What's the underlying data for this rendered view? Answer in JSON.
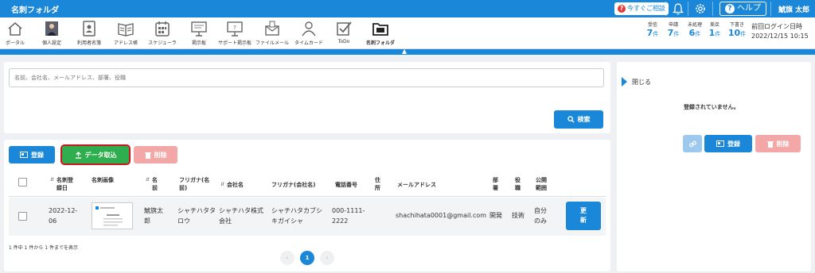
{
  "header": {
    "app_title": "名刺フォルダ",
    "contact_label": "今すぐご相談",
    "help_label": "ヘルプ",
    "user_name": "鯱旗 太郎"
  },
  "nav": {
    "items": [
      {
        "label": "ポータル",
        "icon": "home-icon"
      },
      {
        "label": "個人設定",
        "icon": "avatar-icon"
      },
      {
        "label": "利用者名簿",
        "icon": "contact-book-icon"
      },
      {
        "label": "アドレス帳",
        "icon": "address-book-icon"
      },
      {
        "label": "スケジューラ",
        "icon": "calendar-icon"
      },
      {
        "label": "掲示板",
        "icon": "board-icon"
      },
      {
        "label": "サポート掲示板",
        "icon": "support-board-icon"
      },
      {
        "label": "ファイルメール",
        "icon": "file-mail-icon"
      },
      {
        "label": "タイムカード",
        "icon": "timecard-icon"
      },
      {
        "label": "ToDo",
        "icon": "todo-check-icon"
      },
      {
        "label": "名刺フォルダ",
        "icon": "business-card-folder-icon"
      }
    ],
    "active": "名刺フォルダ"
  },
  "stats": [
    {
      "label": "受信",
      "value": "7",
      "unit": "件"
    },
    {
      "label": "申請",
      "value": "7",
      "unit": "件"
    },
    {
      "label": "未処理",
      "value": "6",
      "unit": "件"
    },
    {
      "label": "差戻",
      "value": "1",
      "unit": "件"
    },
    {
      "label": "下書き",
      "value": "10",
      "unit": "件"
    }
  ],
  "last_login": {
    "label": "前回ログイン日時",
    "value": "2022/12/15 10:15"
  },
  "search": {
    "placeholder": "名前、会社名、メールアドレス、部署、役職",
    "button_label": "検索"
  },
  "toolbar": {
    "register_label": "登録",
    "import_label": "データ取込",
    "delete_label": "削除"
  },
  "table": {
    "headers": {
      "reg_date": "名刺登録日",
      "image": "名刺画像",
      "name": "名前",
      "furigana": "フリガナ(名前)",
      "company": "会社名",
      "company_furigana": "フリガナ(会社名)",
      "phone": "電話番号",
      "address": "住所",
      "email": "メールアドレス",
      "department": "部署",
      "position": "役職",
      "scope": "公開範囲"
    },
    "rows": [
      {
        "reg_date": "2022-12-06",
        "name": "鯱旗太郎",
        "furigana": "シャチハタタロウ",
        "company": "シャチハタ株式会社",
        "company_furigana": "シャチハタカブシキガイシャ",
        "phone": "000-1111-2222",
        "address": "",
        "email": "shachihata0001@gmail.com",
        "department": "開発",
        "position": "技術",
        "scope": "自分のみ",
        "update_label": "更新"
      }
    ],
    "count_text": "1 件中 1 件から 1 件までを表示",
    "current_page": "1"
  },
  "side_panel": {
    "close_label": "閉じる",
    "empty_text": "登録されていません。",
    "register_label": "登録",
    "delete_label": "削除"
  },
  "colors": {
    "primary": "#1a87d8",
    "success": "#2fae4f",
    "danger_light": "#f4a7a7",
    "highlight": "#c8161d"
  }
}
